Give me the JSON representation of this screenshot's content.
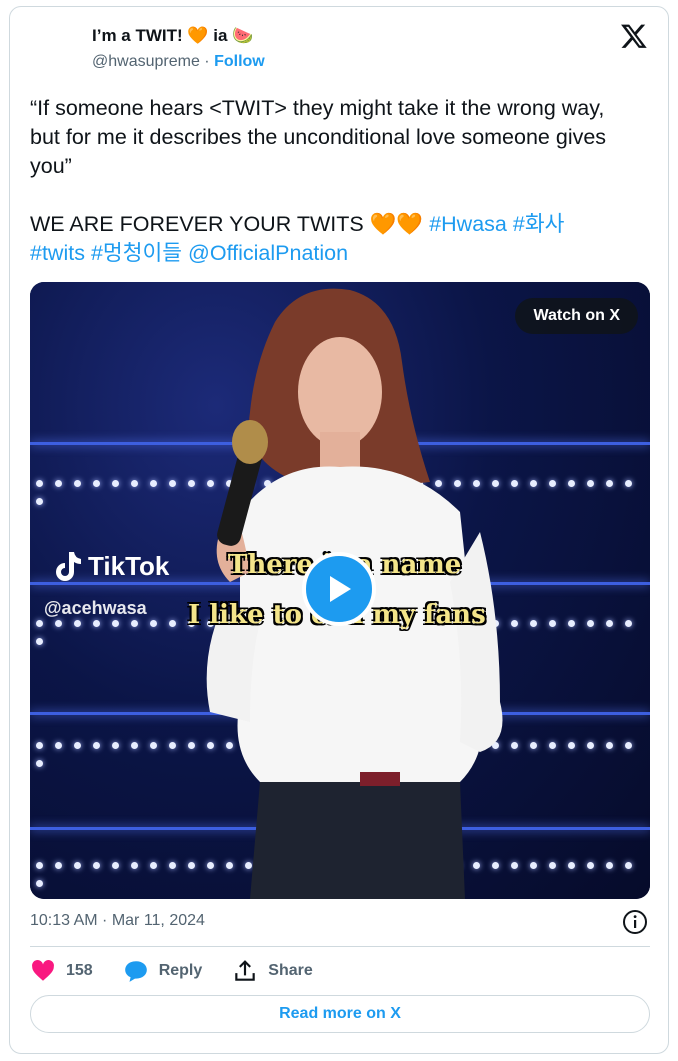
{
  "author": {
    "display_name": "I’m a TWIT! 🧡 ia 🍉",
    "handle": "@hwasupreme",
    "separator": "·",
    "follow_label": "Follow"
  },
  "tweet": {
    "quote": "“If someone hears <TWIT> they might take it the wrong way, but for me it describes the unconditional love someone gives you”",
    "line2_text": "WE ARE FOREVER YOUR TWITS 🧡🧡 ",
    "hashtags": [
      "#Hwasa",
      "#화사",
      "#twits",
      "#멍청이들"
    ],
    "mention": "@OfficialPnation"
  },
  "media": {
    "watch_label": "Watch on X",
    "tiktok_label": "TikTok",
    "tiktok_handle": "@acehwasa",
    "caption_line1": "There is a name",
    "caption_line2": "I like to call my fans"
  },
  "meta": {
    "timestamp": "10:13 AM · Mar 11, 2024"
  },
  "actions": {
    "likes_count": "158",
    "reply_label": "Reply",
    "share_label": "Share"
  },
  "read_more_label": "Read more on X",
  "colors": {
    "accent": "#1d9bf0",
    "heart": "#f91880",
    "text": "#0f1419",
    "muted": "#536471"
  },
  "icons": [
    "x-logo-icon",
    "play-icon",
    "info-icon",
    "heart-icon",
    "reply-icon",
    "share-icon",
    "tiktok-icon"
  ]
}
